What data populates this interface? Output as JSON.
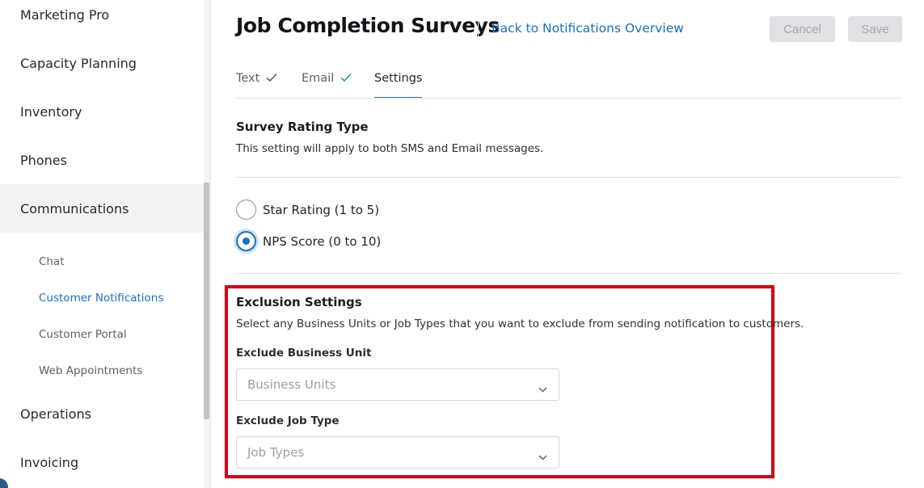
{
  "sidebar": {
    "items": [
      {
        "label": "Marketing Pro"
      },
      {
        "label": "Capacity Planning"
      },
      {
        "label": "Inventory"
      },
      {
        "label": "Phones"
      },
      {
        "label": "Communications"
      }
    ],
    "subitems": [
      {
        "label": "Chat"
      },
      {
        "label": "Customer Notifications"
      },
      {
        "label": "Customer Portal"
      },
      {
        "label": "Web Appointments"
      }
    ],
    "bottom_items": [
      {
        "label": "Operations"
      },
      {
        "label": "Invoicing"
      }
    ]
  },
  "header": {
    "title": "Job Completion Surveys",
    "back_link": "Back to Notifications Overview",
    "cancel_label": "Cancel",
    "save_label": "Save"
  },
  "tabs": [
    {
      "label": "Text"
    },
    {
      "label": "Email"
    },
    {
      "label": "Settings"
    }
  ],
  "survey": {
    "heading": "Survey Rating Type",
    "description": "This setting will apply to both SMS and Email messages.",
    "options": [
      {
        "label": "Star Rating (1 to 5)"
      },
      {
        "label": "NPS Score (0 to 10)"
      }
    ]
  },
  "exclusion": {
    "heading": "Exclusion Settings",
    "description": "Select any Business Units or Job Types that you want to exclude from sending notification to customers.",
    "business_unit_label": "Exclude Business Unit",
    "business_unit_placeholder": "Business Units",
    "job_type_label": "Exclude Job Type",
    "job_type_placeholder": "Job Types"
  },
  "colors": {
    "accent": "#1a70c4",
    "check_green": "#2e9e6a",
    "highlight_red": "#d0021b"
  }
}
